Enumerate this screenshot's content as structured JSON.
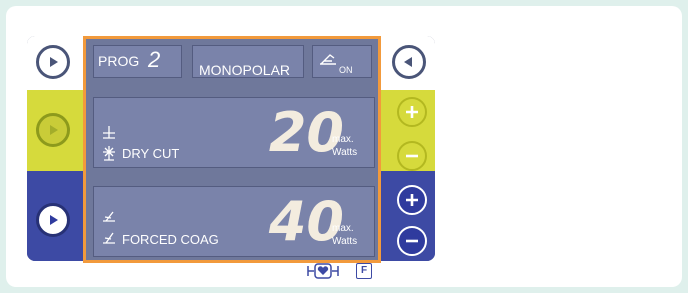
{
  "header": {
    "prog_label": "PROG",
    "prog_number": "2",
    "mode": "MONOPOLAR",
    "pedal_state": "ON"
  },
  "cut": {
    "value": "20",
    "unit_line1": "max.",
    "unit_line2": "Watts",
    "label": "DRY CUT"
  },
  "coag": {
    "value": "40",
    "unit_line1": "max.",
    "unit_line2": "Watts",
    "label": "FORCED COAG"
  },
  "footer": {
    "function_key": "F"
  },
  "icons": {
    "play": "play-icon",
    "rewind": "rewind-icon",
    "plus": "plus-icon",
    "minus": "minus-icon",
    "pedal": "footswitch-icon",
    "heart": "heart-electrode-icon",
    "cut": "cut-electrode-icon",
    "coag": "coag-electrode-icon"
  },
  "colors": {
    "highlight_frame": "#f29a3c",
    "lime_band": "#d6da3c",
    "blue_band": "#3d4aa4",
    "screen": "#6f789b",
    "digits": "#f3ecdf"
  }
}
